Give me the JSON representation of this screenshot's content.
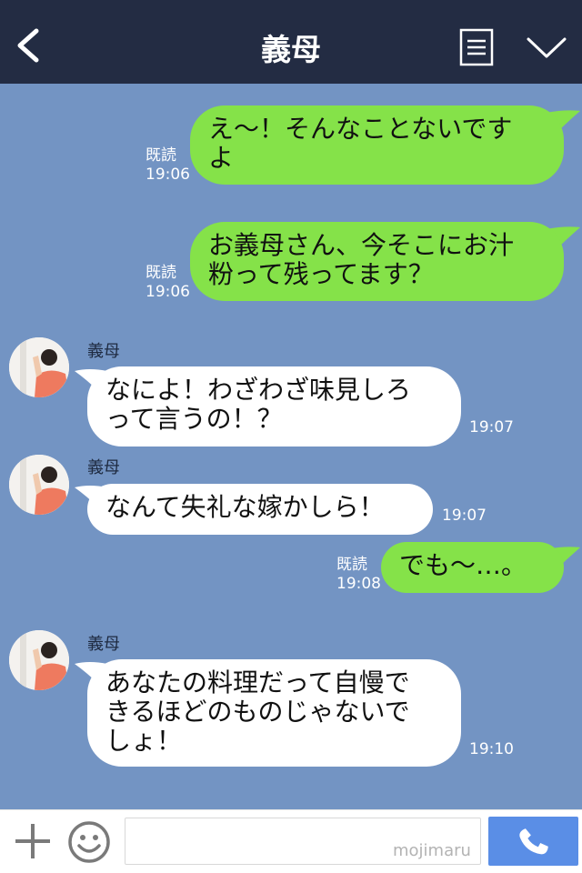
{
  "header": {
    "title": "義母",
    "back_icon": "back-chevron-icon",
    "menu_icon": "menu-list-icon",
    "expand_icon": "chevron-down-icon"
  },
  "messages": [
    {
      "side": "me",
      "text": "え〜！そんなことないです\nよ",
      "read": "既読",
      "time": "19:06"
    },
    {
      "side": "me",
      "text": "お義母さん、今そこにお汁\n粉って残ってます？",
      "read": "既読",
      "time": "19:06"
    },
    {
      "side": "them",
      "sender": "義母",
      "text": "なによ！わざわざ味見しろ\nって言うの！？",
      "time": "19:07"
    },
    {
      "side": "them",
      "sender": "義母",
      "text": "なんて失礼な嫁かしら！",
      "time": "19:07"
    },
    {
      "side": "me",
      "text": "でも〜…。",
      "read": "既読",
      "time": "19:08"
    },
    {
      "side": "them",
      "sender": "義母",
      "text": "あなたの料理だって自慢で\nきるほどのものじゃないで\nしょ！",
      "time": "19:10"
    }
  ],
  "footer": {
    "input_value": "",
    "input_placeholder": "",
    "watermark": "mojimaru",
    "plus_icon": "plus-icon",
    "emoji_icon": "smiley-icon",
    "call_icon": "phone-icon"
  },
  "colors": {
    "header_bg": "#232c43",
    "chat_bg": "#7394c3",
    "my_bubble": "#85e249",
    "their_bubble": "#ffffff",
    "call_button": "#5a8ee6"
  }
}
